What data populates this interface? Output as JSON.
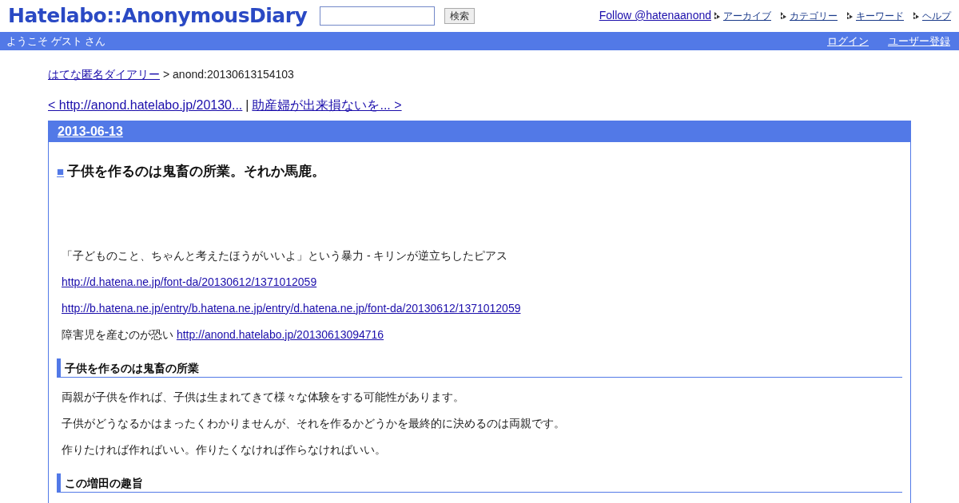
{
  "header": {
    "logo": "Hatelabo::AnonymousDiary",
    "search_button": "検索",
    "follow_link": "Follow @hatenaanond",
    "nav_links": [
      "アーカイブ",
      "カテゴリー",
      "キーワード",
      "ヘルプ"
    ]
  },
  "welcome_bar": {
    "greeting": "ようこそ ゲスト さん",
    "links": [
      "ログイン",
      "ユーザー登録"
    ]
  },
  "breadcrumb": {
    "link": "はてな匿名ダイアリー",
    "current": "> anond:20130613154103"
  },
  "pager": {
    "prev": "< http://anond.hatelabo.jp/20130...",
    "separator": "|",
    "next": "助産婦が出来損ないを... >"
  },
  "day": {
    "date": "2013-06-13",
    "entry": {
      "marker": "■",
      "title": "子供を作るのは鬼畜の所業。それか馬鹿。",
      "paragraphs": [
        {
          "text": "「子どものこと、ちゃんと考えたほうがいいよ」という暴力 - キリンが逆立ちしたピアス"
        },
        {
          "link": "http://d.hatena.ne.jp/font-da/20130612/1371012059"
        },
        {
          "link": "http://b.hatena.ne.jp/entry/b.hatena.ne.jp/entry/d.hatena.ne.jp/font-da/20130612/1371012059"
        },
        {
          "text": "障害児を産むのが恐い",
          "link": "http://anond.hatelabo.jp/20130613094716"
        }
      ],
      "sections": [
        {
          "heading": "子供を作るのは鬼畜の所業",
          "paragraphs": [
            {
              "text": "両親が子供を作れば、子供は生まれてきて様々な体験をする可能性があります。"
            },
            {
              "text": "子供がどうなるかはまったくわかりませんが、それを作るかどうかを最終的に決めるのは両親です。"
            },
            {
              "text": "作りたければ作ればいい。作りたくなければ作らなければいい。"
            }
          ]
        },
        {
          "heading": "この増田の趣旨"
        }
      ]
    }
  }
}
